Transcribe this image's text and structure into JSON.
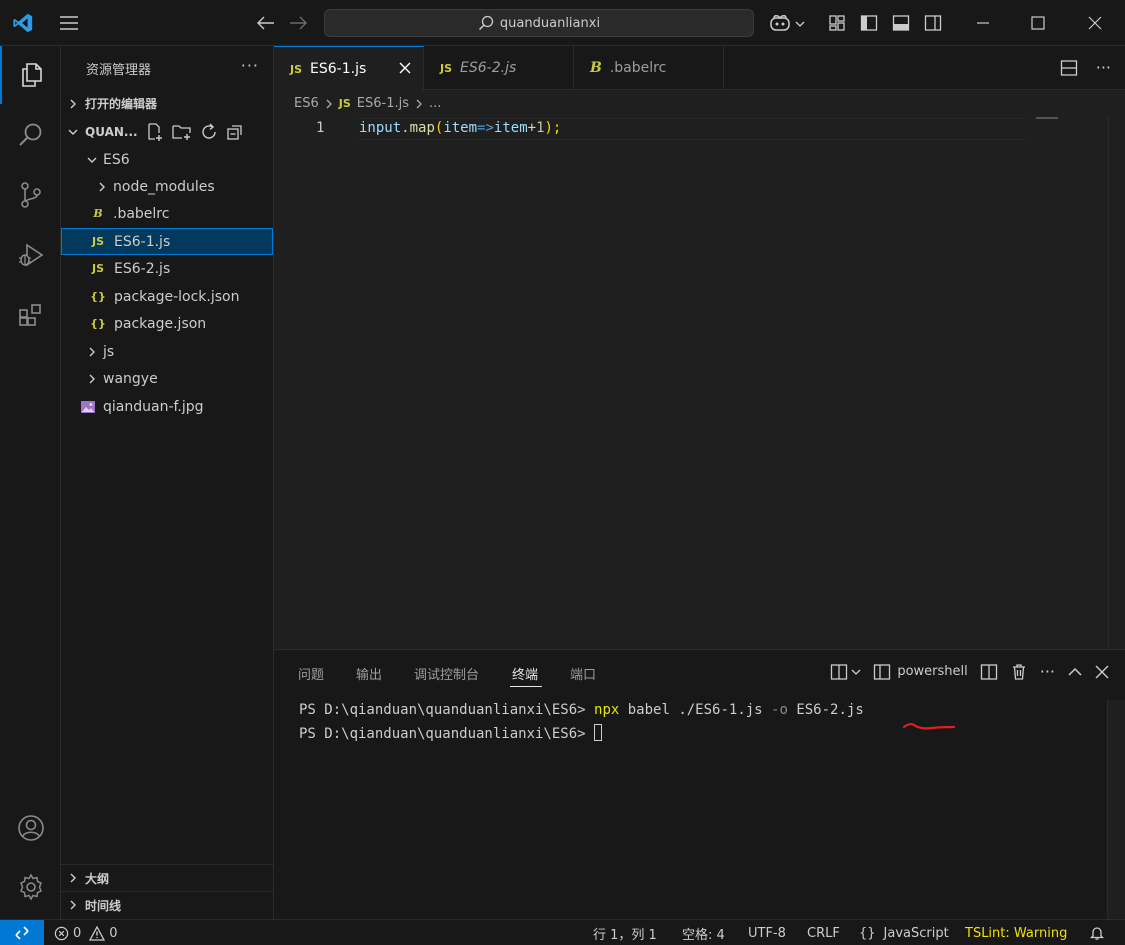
{
  "titlebar": {
    "search_text": "quanduanlianxi"
  },
  "sidebar": {
    "title": "资源管理器",
    "more": "···",
    "open_editors": "打开的编辑器",
    "project": "QUAN...",
    "outline": "大纲",
    "timeline": "时间线",
    "tree": [
      {
        "label": "ES6",
        "kind": "folder-open"
      },
      {
        "label": "node_modules",
        "kind": "folder"
      },
      {
        "label": ".babelrc",
        "kind": "babel"
      },
      {
        "label": "ES6-1.js",
        "kind": "js",
        "selected": true
      },
      {
        "label": "ES6-2.js",
        "kind": "js"
      },
      {
        "label": "package-lock.json",
        "kind": "json"
      },
      {
        "label": "package.json",
        "kind": "json"
      },
      {
        "label": "js",
        "kind": "folder"
      },
      {
        "label": "wangye",
        "kind": "folder"
      },
      {
        "label": "qianduan-f.jpg",
        "kind": "image"
      }
    ],
    "js_badge": "JS",
    "json_badge": "{}",
    "babel_badge": "B"
  },
  "tabs": [
    {
      "label": "ES6-1.js",
      "active": true
    },
    {
      "label": "ES6-2.js",
      "active": false
    },
    {
      "label": ".babelrc",
      "active": false
    }
  ],
  "breadcrumb": {
    "folder": "ES6",
    "file": "ES6-1.js",
    "rest": "..."
  },
  "editor": {
    "line_number": "1",
    "code_tokens": [
      "input",
      ".",
      "map",
      "(",
      "item",
      "=>",
      "item",
      "+",
      "1",
      ");"
    ]
  },
  "panel": {
    "tabs": [
      "问题",
      "输出",
      "调试控制台",
      "终端",
      "端口"
    ],
    "active_tab": "终端",
    "shell": "powershell",
    "more": "···",
    "terminal": {
      "prompt": "PS D:\\qianduan\\quanduanlianxi\\ES6> ",
      "cmd_npx": "npx",
      "cmd_rest_1": " babel ./ES6-1.js ",
      "cmd_flag": "-o",
      "cmd_rest_2": " ES6-2.js",
      "prompt2": "PS D:\\qianduan\\quanduanlianxi\\ES6> "
    }
  },
  "statusbar": {
    "errors": "0",
    "warnings": "0",
    "position": "行 1，列 1",
    "spaces": "空格: 4",
    "encoding": "UTF-8",
    "eol": "CRLF",
    "language": "JavaScript",
    "language_icon": "{}",
    "tslint": "TSLint: Warning"
  },
  "colors": {
    "accent": "#0078d4",
    "js_yellow": "#cbcb41",
    "tslint_yellow": "#f0e000",
    "annotation_red": "#e02020"
  }
}
